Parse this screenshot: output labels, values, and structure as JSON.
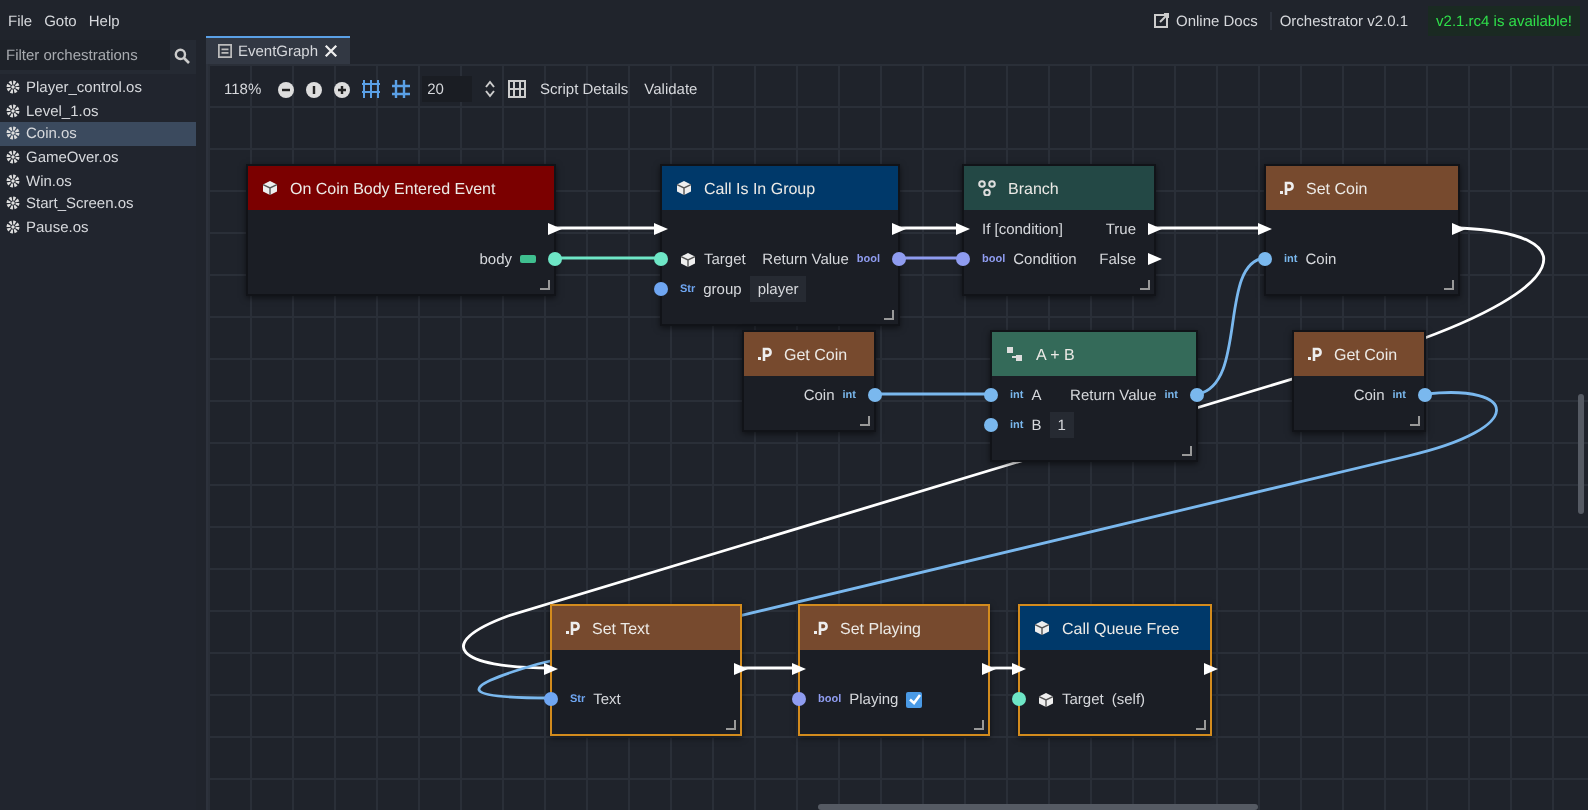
{
  "menu": [
    "File",
    "Goto",
    "Help"
  ],
  "header": {
    "docs": "Online Docs",
    "version": "Orchestrator v2.0.1",
    "update": "v2.1.rc4 is available!"
  },
  "sidebar": {
    "filter_placeholder": "Filter orchestrations",
    "items": [
      {
        "label": "Player_control.os",
        "selected": false
      },
      {
        "label": "Level_1.os",
        "selected": false
      },
      {
        "label": "Coin.os",
        "selected": true
      },
      {
        "label": "GameOver.os",
        "selected": false
      },
      {
        "label": "Win.os",
        "selected": false
      },
      {
        "label": "Start_Screen.os",
        "selected": false
      },
      {
        "label": "Pause.os",
        "selected": false
      }
    ]
  },
  "tabs": [
    {
      "label": "EventGraph",
      "selected": true
    }
  ],
  "toolbar": {
    "zoom": "118%",
    "snap": "20",
    "buttons": [
      "Script Details",
      "Validate"
    ]
  },
  "graph": {
    "nodes": [
      {
        "title": "On Coin Body Entered Event",
        "kind": "event",
        "selected": false,
        "rows": [
          {
            "right": {
              "kind": "exec"
            }
          },
          {
            "right": {
              "kind": "object",
              "label": "body",
              "color": "#6ee6c6"
            }
          }
        ]
      },
      {
        "title": "Call Is In Group",
        "kind": "call",
        "selected": false,
        "rows": [
          {
            "left": {
              "kind": "exec"
            },
            "right": {
              "kind": "exec"
            }
          },
          {
            "left": {
              "kind": "object",
              "label": "Target",
              "color": "#6ee6c6"
            },
            "right": {
              "kind": "data",
              "label": "Return Value",
              "badge": "bool",
              "color": "#8f9cf0"
            }
          },
          {
            "left": {
              "kind": "data",
              "label": "group",
              "badge": "Str",
              "color": "#6fa6f2",
              "value": "player"
            }
          }
        ]
      },
      {
        "title": "Branch",
        "kind": "branch",
        "selected": false,
        "rows": [
          {
            "left": {
              "kind": "exec",
              "label": "If [condition]"
            },
            "right": {
              "kind": "exec",
              "label": "True"
            }
          },
          {
            "left": {
              "kind": "data",
              "label": "Condition",
              "badge": "bool",
              "color": "#8f9cf0"
            },
            "right": {
              "kind": "exec",
              "label": "False"
            }
          }
        ]
      },
      {
        "title": "Set Coin",
        "kind": "property",
        "selected": false,
        "rows": [
          {
            "left": {
              "kind": "exec"
            },
            "right": {
              "kind": "exec"
            }
          },
          {
            "left": {
              "kind": "data",
              "label": "Coin",
              "badge": "int",
              "color": "#7ab8ee"
            }
          }
        ]
      },
      {
        "title": "Get Coin",
        "kind": "property",
        "selected": false,
        "rows": [
          {
            "right": {
              "kind": "data",
              "label": "Coin",
              "badge": "int",
              "color": "#7ab8ee"
            }
          }
        ]
      },
      {
        "title": "A + B",
        "kind": "operator",
        "selected": false,
        "rows": [
          {
            "left": {
              "kind": "data",
              "label": "A",
              "badge": "int",
              "color": "#7ab8ee"
            },
            "right": {
              "kind": "data",
              "label": "Return Value",
              "badge": "int",
              "color": "#7ab8ee"
            }
          },
          {
            "left": {
              "kind": "data",
              "label": "B",
              "badge": "int",
              "color": "#7ab8ee",
              "value": "1"
            }
          }
        ]
      },
      {
        "title": "Get Coin",
        "kind": "property",
        "selected": false,
        "rows": [
          {
            "right": {
              "kind": "data",
              "label": "Coin",
              "badge": "int",
              "color": "#7ab8ee"
            }
          }
        ]
      },
      {
        "title": "Set Text",
        "kind": "property",
        "selected": true,
        "rows": [
          {
            "left": {
              "kind": "exec"
            },
            "right": {
              "kind": "exec"
            }
          },
          {
            "left": {
              "kind": "data",
              "label": "Text",
              "badge": "Str",
              "color": "#6fa6f2"
            }
          }
        ]
      },
      {
        "title": "Set Playing",
        "kind": "property",
        "selected": true,
        "rows": [
          {
            "left": {
              "kind": "exec"
            },
            "right": {
              "kind": "exec"
            }
          },
          {
            "left": {
              "kind": "data",
              "label": "Playing",
              "badge": "bool",
              "color": "#8f9cf0",
              "checked": true
            }
          }
        ]
      },
      {
        "title": "Call Queue Free",
        "kind": "call",
        "selected": true,
        "rows": [
          {
            "left": {
              "kind": "exec"
            },
            "right": {
              "kind": "exec"
            }
          },
          {
            "left": {
              "kind": "object",
              "label": "Target",
              "color": "#6ee6c6",
              "hint": "(self)"
            }
          }
        ]
      }
    ]
  }
}
